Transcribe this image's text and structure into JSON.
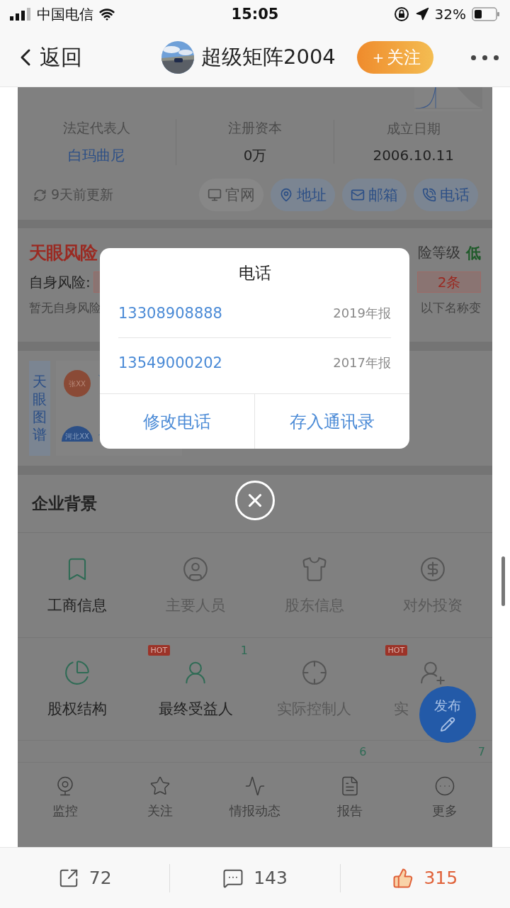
{
  "status_bar": {
    "carrier": "中国电信",
    "time": "15:05",
    "battery": "32%"
  },
  "nav": {
    "back": "返回",
    "title": "超级矩阵2004",
    "follow": "＋关注"
  },
  "shot": {
    "facts": [
      {
        "label": "法定代表人",
        "value": "白玛曲尼",
        "link": true
      },
      {
        "label": "注册资本",
        "value": "0万",
        "link": false
      },
      {
        "label": "成立日期",
        "value": "2006.10.11",
        "link": false
      }
    ],
    "updated": "9天前更新",
    "chips": [
      {
        "label": "官网",
        "disabled": true
      },
      {
        "label": "地址",
        "disabled": false
      },
      {
        "label": "邮箱",
        "disabled": false
      },
      {
        "label": "电话",
        "disabled": false
      }
    ],
    "risk": {
      "logo": "天眼风险",
      "level_label": "险等级",
      "level": "低",
      "self_label": "自身风险:",
      "count": "2条",
      "note_left": "暂无自身风险",
      "note_right": "以下名称变"
    },
    "graph": {
      "label": "天眼图谱",
      "nodes": [
        "张XX",
        "河北XX"
      ]
    },
    "background": {
      "title": "企业背景",
      "items": [
        {
          "label": "工商信息",
          "disabled": false
        },
        {
          "label": "主要人员",
          "disabled": true
        },
        {
          "label": "股东信息",
          "disabled": true
        },
        {
          "label": "对外投资",
          "disabled": true
        },
        {
          "label": "股权结构",
          "disabled": false
        },
        {
          "label": "最终受益人",
          "disabled": false,
          "badge": "HOT",
          "count": "1"
        },
        {
          "label": "实际控制人",
          "disabled": true
        },
        {
          "label": "实",
          "disabled": true,
          "badge": "HOT",
          "clipped": true
        }
      ],
      "more_counts": [
        "6",
        "7"
      ]
    },
    "toolbar": [
      "监控",
      "关注",
      "情报动态",
      "报告",
      "更多"
    ],
    "dialog": {
      "title": "电话",
      "phones": [
        {
          "number": "13308908888",
          "source": "2019年报"
        },
        {
          "number": "13549000202",
          "source": "2017年报"
        }
      ],
      "actions": [
        "修改电话",
        "存入通讯录"
      ]
    },
    "fab": "发布"
  },
  "actions": [
    {
      "kind": "share",
      "count": "72",
      "selected": false
    },
    {
      "kind": "comment",
      "count": "143",
      "selected": false
    },
    {
      "kind": "like",
      "count": "315",
      "selected": true
    }
  ]
}
